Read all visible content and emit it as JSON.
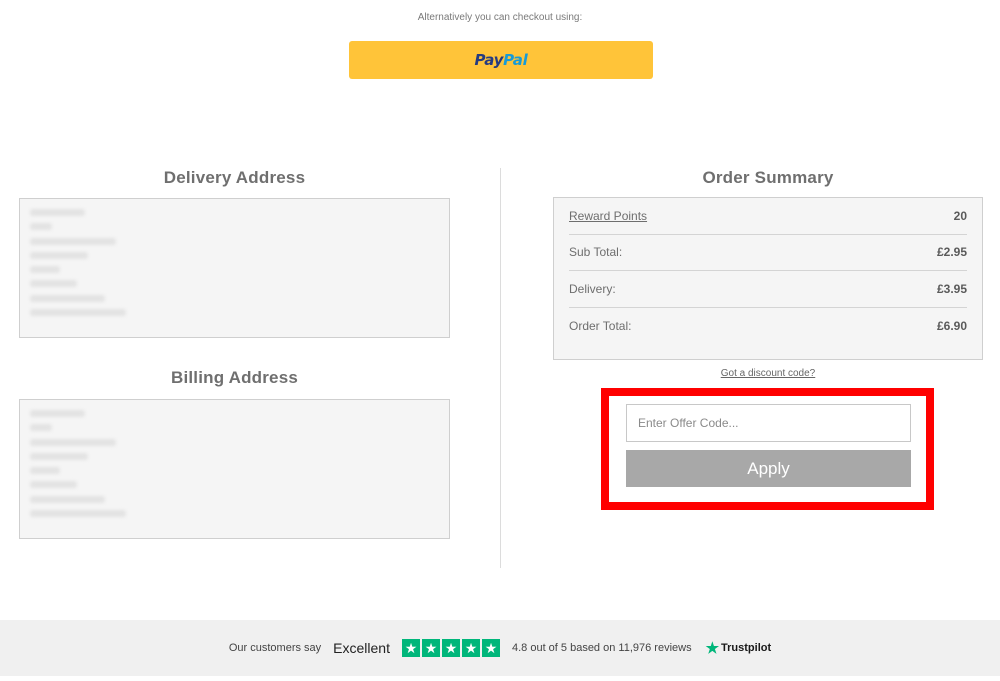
{
  "checkout_alt": {
    "text": "Alternatively you can checkout using:",
    "paypal_part1": "Pay",
    "paypal_part2": "Pal"
  },
  "delivery": {
    "title": "Delivery Address"
  },
  "billing": {
    "title": "Billing Address"
  },
  "summary": {
    "title": "Order Summary",
    "rows": [
      {
        "label": "Reward Points",
        "value": "20"
      },
      {
        "label": "Sub Total:",
        "value": "£2.95"
      },
      {
        "label": "Delivery:",
        "value": "£3.95"
      },
      {
        "label": "Order Total:",
        "value": "£6.90"
      }
    ]
  },
  "discount": {
    "link": "Got a discount code?",
    "placeholder": "Enter Offer Code...",
    "apply_label": "Apply"
  },
  "trustpilot": {
    "say": "Our customers say",
    "excellent": "Excellent",
    "rating_text": "4.8 out of 5 based on 11,976 reviews",
    "brand": "Trustpilot",
    "stars": 5
  },
  "colors": {
    "paypal_yellow": "#ffc439",
    "highlight_red": "#ff0000",
    "trustpilot_green": "#00b67a",
    "apply_grey": "#a8a8a8"
  },
  "icons": [
    "paypal-logo",
    "trustpilot-star-icon"
  ]
}
